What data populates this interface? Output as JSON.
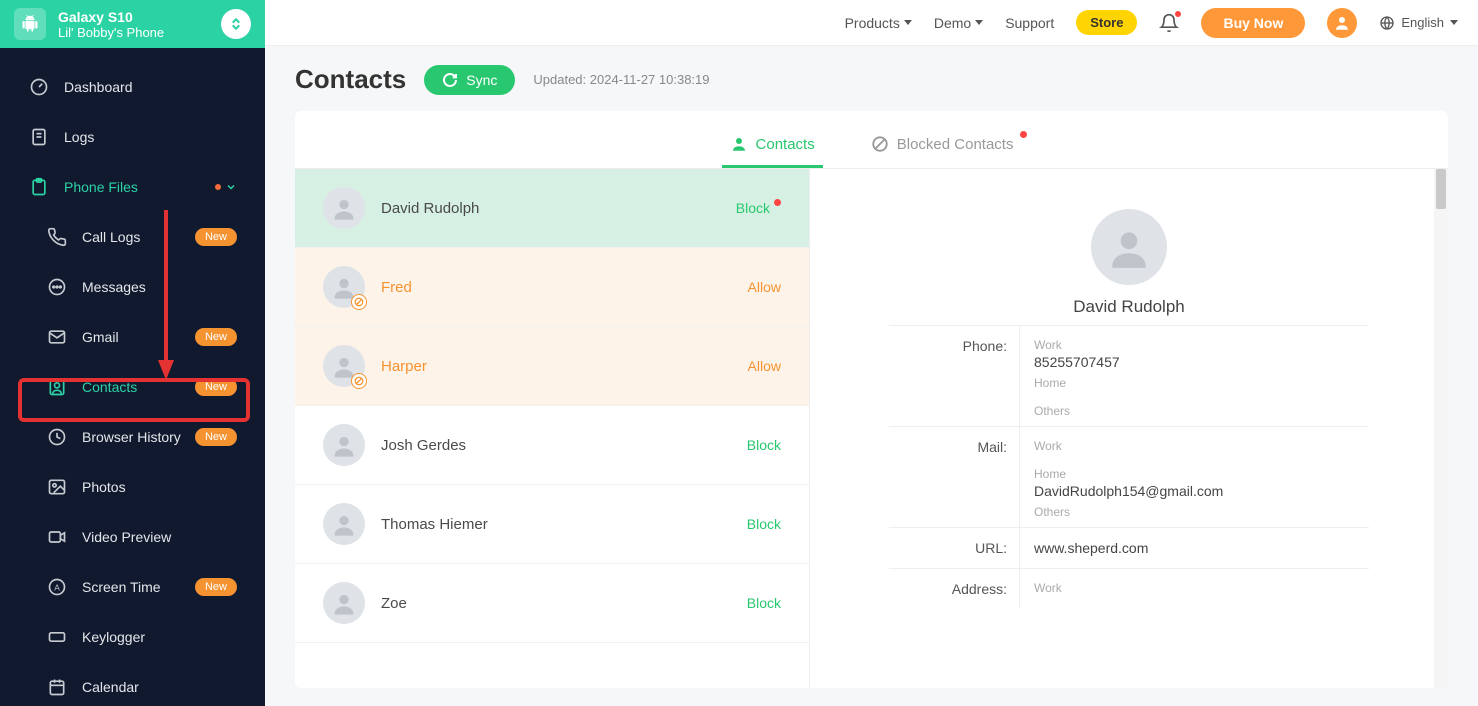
{
  "sidebar": {
    "device_name": "Galaxy S10",
    "device_sub": "Lil' Bobby's Phone",
    "items": {
      "dashboard": "Dashboard",
      "logs": "Logs",
      "phone_files": "Phone Files",
      "call_logs": "Call Logs",
      "messages": "Messages",
      "gmail": "Gmail",
      "contacts": "Contacts",
      "browser_history": "Browser History",
      "photos": "Photos",
      "video_preview": "Video Preview",
      "screen_time": "Screen Time",
      "keylogger": "Keylogger",
      "calendar": "Calendar"
    },
    "badge_new": "New"
  },
  "topbar": {
    "products": "Products",
    "demo": "Demo",
    "support": "Support",
    "store": "Store",
    "buy_now": "Buy Now",
    "language": "English"
  },
  "page": {
    "title": "Contacts",
    "sync": "Sync",
    "updated": "Updated: 2024-11-27 10:38:19"
  },
  "tabs": {
    "contacts": "Contacts",
    "blocked": "Blocked Contacts"
  },
  "actions": {
    "block": "Block",
    "allow": "Allow"
  },
  "contacts": [
    {
      "name": "David Rudolph",
      "action": "block",
      "selected": true,
      "blocked": false,
      "action_dot": true
    },
    {
      "name": "Fred",
      "action": "allow",
      "selected": false,
      "blocked": true
    },
    {
      "name": "Harper",
      "action": "allow",
      "selected": false,
      "blocked": true
    },
    {
      "name": "Josh Gerdes",
      "action": "block",
      "selected": false,
      "blocked": false
    },
    {
      "name": "Thomas Hiemer",
      "action": "block",
      "selected": false,
      "blocked": false
    },
    {
      "name": "Zoe",
      "action": "block",
      "selected": false,
      "blocked": false
    }
  ],
  "detail": {
    "name": "David Rudolph",
    "phone_label": "Phone:",
    "mail_label": "Mail:",
    "url_label": "URL:",
    "address_label": "Address:",
    "labels": {
      "work": "Work",
      "home": "Home",
      "others": "Others"
    },
    "phone_work": "85255707457",
    "mail_home": "DavidRudolph154@gmail.com",
    "url": "www.sheperd.com"
  }
}
